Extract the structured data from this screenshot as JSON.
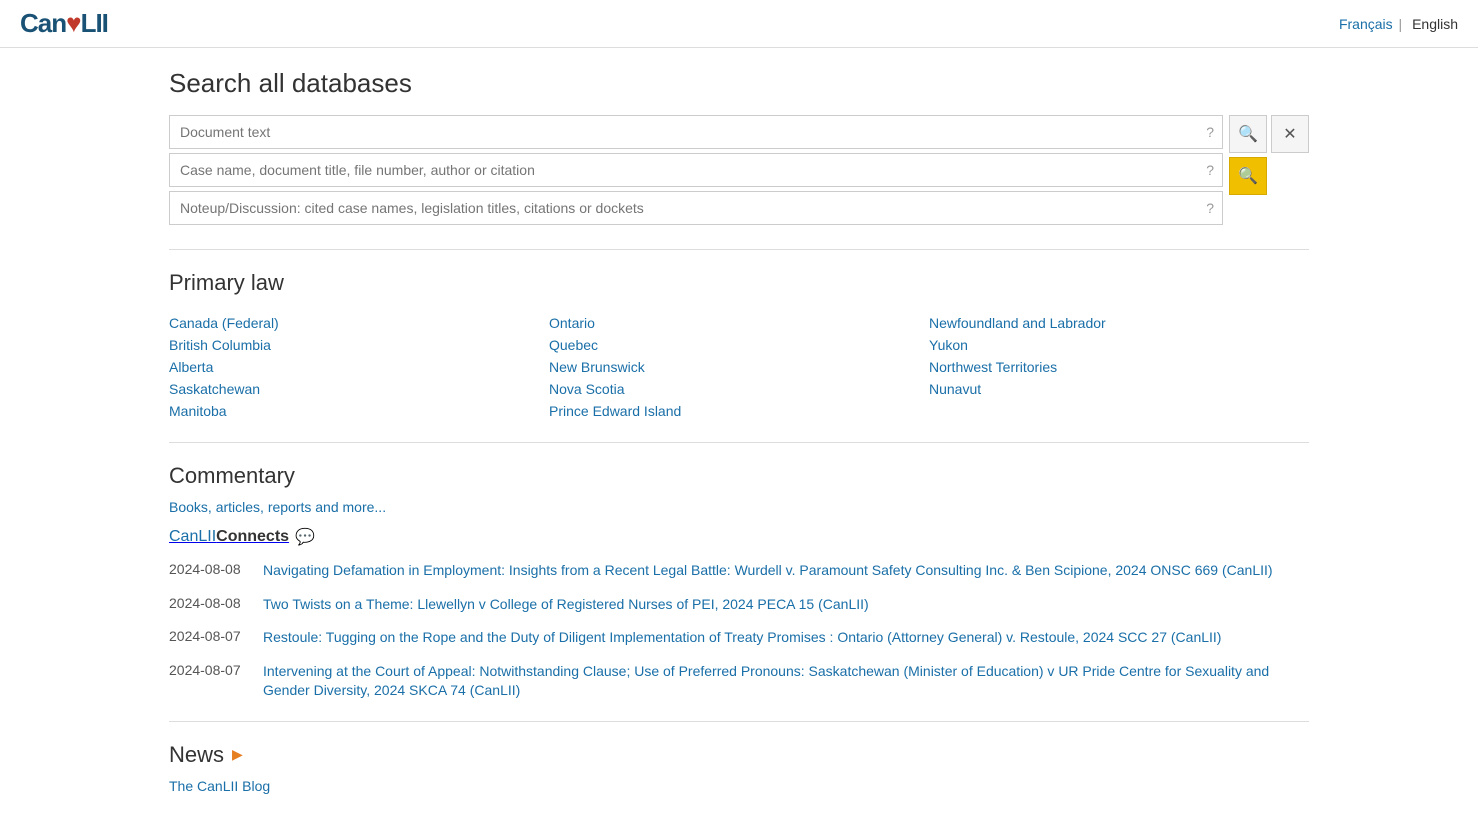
{
  "header": {
    "logo_can": "Can",
    "logo_lii": "LII",
    "lang_fr": "Français",
    "lang_sep": "|",
    "lang_en": "English"
  },
  "search": {
    "title": "Search all databases",
    "field1_placeholder": "Document text",
    "field2_placeholder": "Case name, document title, file number, author or citation",
    "field3_placeholder": "Noteup/Discussion: cited case names, legislation titles, citations or dockets",
    "help_label": "?",
    "search_btn_label": "🔍",
    "clear_btn_label": "✕",
    "search_yellow_label": "🔍"
  },
  "primary_law": {
    "title": "Primary law",
    "column1": [
      {
        "label": "Canada (Federal)",
        "id": "canada-federal"
      },
      {
        "label": "British Columbia",
        "id": "british-columbia"
      },
      {
        "label": "Alberta",
        "id": "alberta"
      },
      {
        "label": "Saskatchewan",
        "id": "saskatchewan"
      },
      {
        "label": "Manitoba",
        "id": "manitoba"
      }
    ],
    "column2": [
      {
        "label": "Ontario",
        "id": "ontario"
      },
      {
        "label": "Quebec",
        "id": "quebec"
      },
      {
        "label": "New Brunswick",
        "id": "new-brunswick"
      },
      {
        "label": "Nova Scotia",
        "id": "nova-scotia"
      },
      {
        "label": "Prince Edward Island",
        "id": "prince-edward-island"
      }
    ],
    "column3": [
      {
        "label": "Newfoundland and Labrador",
        "id": "newfoundland-labrador"
      },
      {
        "label": "Yukon",
        "id": "yukon"
      },
      {
        "label": "Northwest Territories",
        "id": "northwest-territories"
      },
      {
        "label": "Nunavut",
        "id": "nunavut"
      }
    ]
  },
  "commentary": {
    "title": "Commentary",
    "books_link": "Books, articles, reports and more...",
    "connects_label": "CanLII",
    "connects_bold": "Connects",
    "connects_icon": "💬"
  },
  "connects_items": [
    {
      "date": "2024-08-08",
      "text": "Navigating Defamation in Employment: Insights from a Recent Legal Battle: Wurdell v. Paramount Safety Consulting Inc. & Ben Scipione, 2024 ONSC 669 (CanLII)"
    },
    {
      "date": "2024-08-08",
      "text": "Two Twists on a Theme: Llewellyn v College of Registered Nurses of PEI, 2024 PECA 15 (CanLII)"
    },
    {
      "date": "2024-08-07",
      "text": "Restoule: Tugging on the Rope and the Duty of Diligent Implementation of Treaty Promises  : Ontario (Attorney General) v. Restoule, 2024 SCC 27 (CanLII)"
    },
    {
      "date": "2024-08-07",
      "text": "Intervening at the Court of Appeal: Notwithstanding Clause; Use of Preferred Pronouns: Saskatchewan (Minister of Education) v UR Pride Centre for Sexuality and Gender Diversity, 2024 SKCA 74 (CanLII)"
    }
  ],
  "news": {
    "title": "News",
    "rss_icon": "▶",
    "blog_link": "The CanLII Blog"
  }
}
